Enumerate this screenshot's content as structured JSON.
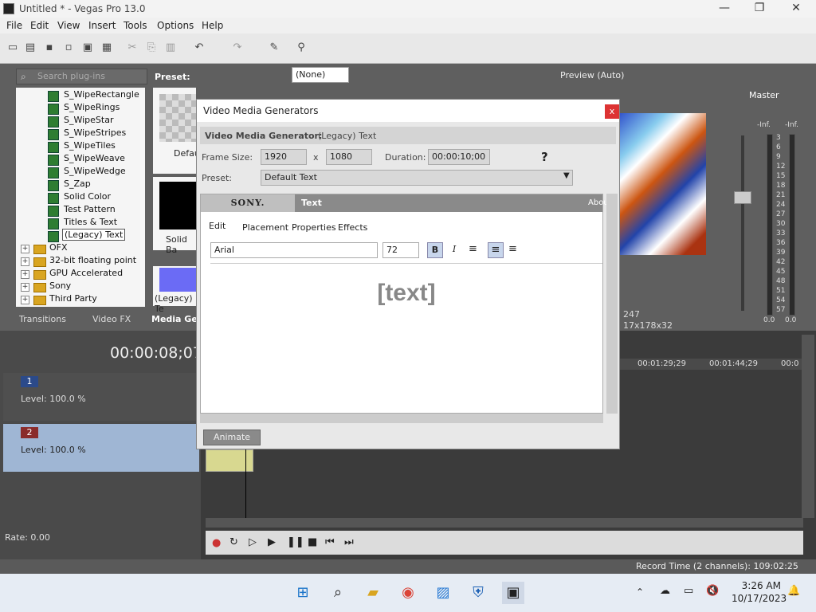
{
  "window": {
    "title": "Untitled * - Vegas Pro 13.0",
    "minimize": "—",
    "restore": "❐",
    "close": "✕"
  },
  "menu": [
    "File",
    "Edit",
    "View",
    "Insert",
    "Tools",
    "Options",
    "Help"
  ],
  "explorer": {
    "search_placeholder": "Search plug-ins",
    "preset_label": "Preset:",
    "items": [
      "S_WipeRectangle",
      "S_WipeRings",
      "S_WipeStar",
      "S_WipeStripes",
      "S_WipeTiles",
      "S_WipeWeave",
      "S_WipeWedge",
      "S_Zap",
      "Solid Color",
      "Test Pattern",
      "Titles & Text",
      "(Legacy) Text"
    ],
    "folders": [
      "OFX",
      "32-bit floating point",
      "GPU Accelerated",
      "Sony",
      "Third Party"
    ],
    "thumbs": [
      "Defau",
      "Solid Ba",
      "(Legacy) Te"
    ],
    "tabs": [
      "Transitions",
      "Video FX",
      "Media Ge"
    ]
  },
  "preview": {
    "none_select": "(None)",
    "quality": "Preview (Auto)",
    "size": "247",
    "dims": "17x178x32"
  },
  "master": {
    "label": "Master",
    "inf_left": "-Inf.",
    "inf_right": "-Inf.",
    "scale": [
      "3",
      "6",
      "9",
      "12",
      "15",
      "18",
      "21",
      "24",
      "27",
      "30",
      "33",
      "36",
      "39",
      "42",
      "45",
      "48",
      "51",
      "54",
      "57"
    ],
    "bottom_left": "0.0",
    "bottom_right": "0.0"
  },
  "timeline": {
    "timecode": "00:00:08;07",
    "markers": [
      "00:01:29;29",
      "00:01:44;29",
      "00:0"
    ],
    "tracks": [
      {
        "number": "1",
        "level": "Level: 100.0 %"
      },
      {
        "number": "2",
        "level": "Level: 100.0 %"
      }
    ],
    "rate": "Rate: 0.00"
  },
  "dialog": {
    "title": "Video Media Generators",
    "close": "x",
    "generator_label": "Video Media Generator:",
    "generator_value": "(Legacy) Text",
    "frame_size_label": "Frame Size:",
    "frame_w": "1920",
    "frame_x": "x",
    "frame_h": "1080",
    "duration_label": "Duration:",
    "duration_value": "00:00:10;00",
    "preset_label": "Preset:",
    "preset_value": "Default Text",
    "brand": "SONY.",
    "plugin_name": "Text",
    "about": "Abou",
    "tabs": [
      "Edit",
      "Placement",
      "Properties",
      "Effects"
    ],
    "font": "Arial",
    "font_size": "72",
    "bold": "B",
    "italic": "I",
    "editor_text": "[text]",
    "animate": "Animate"
  },
  "status": {
    "record_time": "Record Time (2 channels): 109:02:25"
  },
  "taskbar": {
    "time": "3:26 AM",
    "date": "10/17/2023"
  },
  "colors": {
    "accent": "#1a73c9",
    "track_selected": "#9fb6d4",
    "dialog_close": "#d33333"
  }
}
